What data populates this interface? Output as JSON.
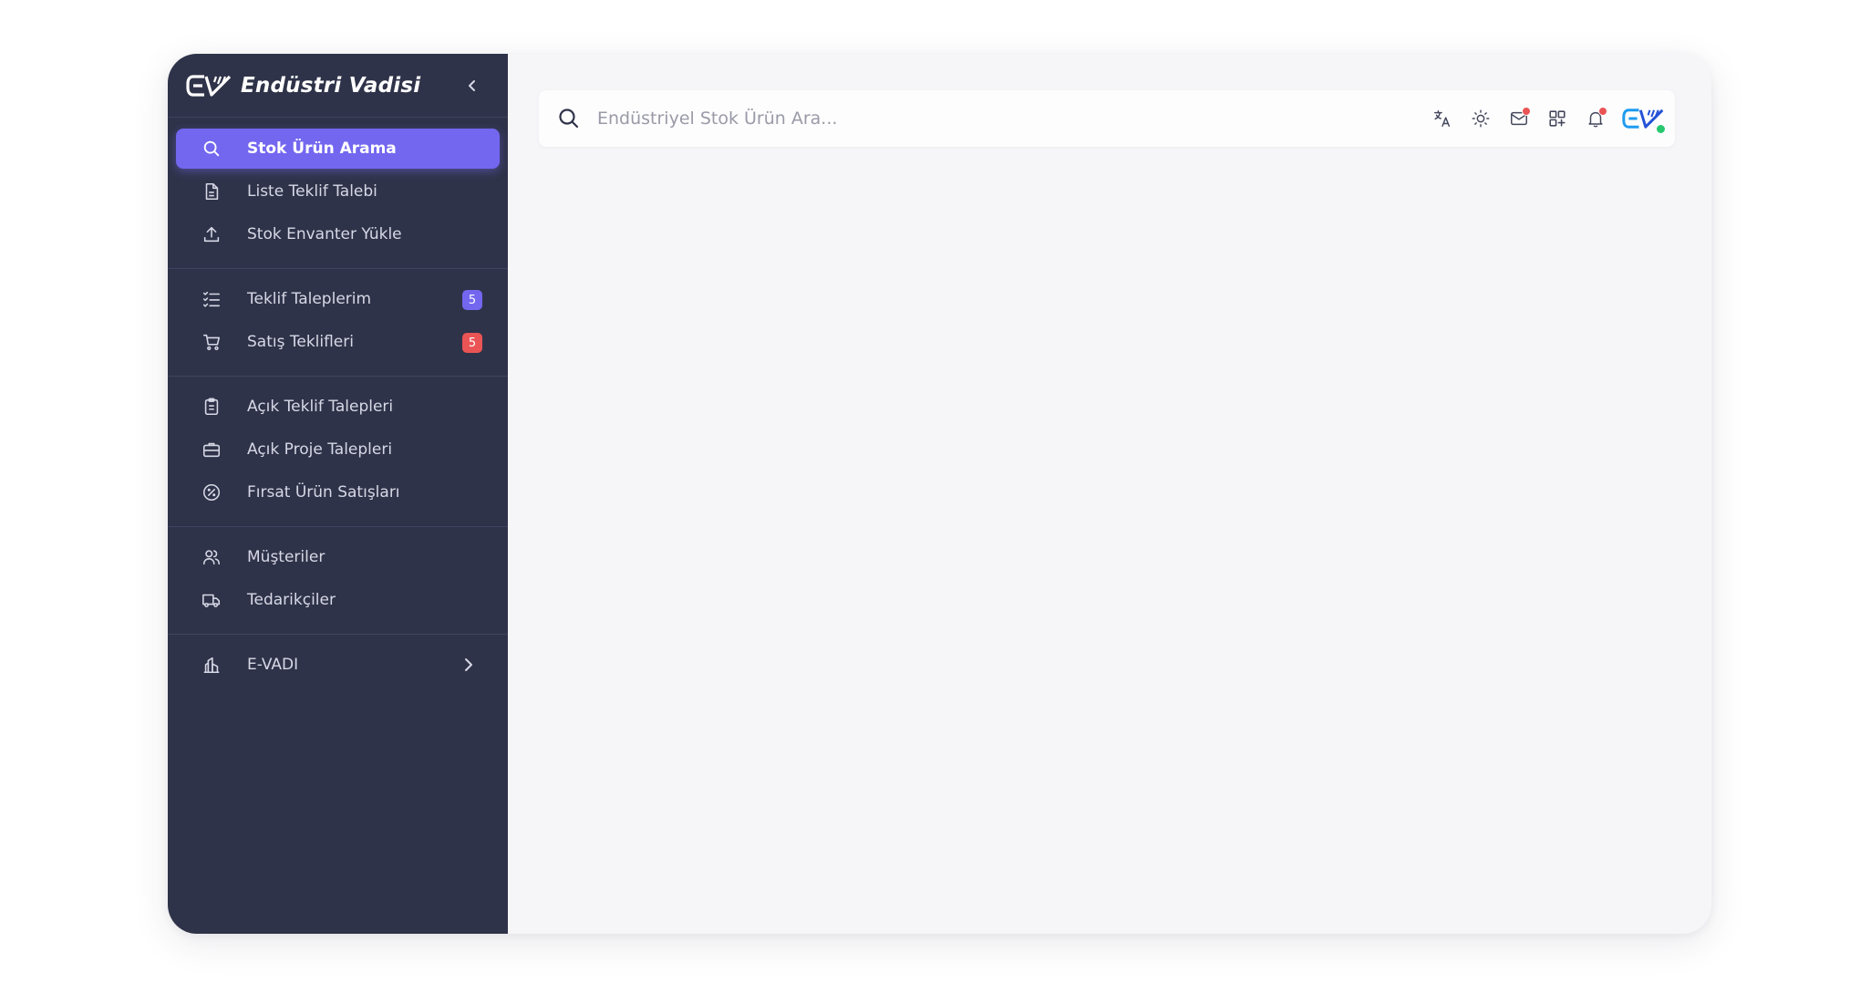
{
  "brand": {
    "name": "Endüstri Vadisi",
    "logo_icon": "ev-logo",
    "collapse_icon": "chevron-left-icon"
  },
  "sidebar": {
    "sections": [
      {
        "items": [
          {
            "label": "Stok Ürün Arama",
            "icon": "search-icon",
            "active": true
          },
          {
            "label": "Liste Teklif Talebi",
            "icon": "file-text-icon"
          },
          {
            "label": "Stok Envanter Yükle",
            "icon": "upload-icon"
          }
        ]
      },
      {
        "items": [
          {
            "label": "Teklif Taleplerim",
            "icon": "checklist-icon",
            "badge": "5",
            "badge_color": "#7367f0"
          },
          {
            "label": "Satış Teklifleri",
            "icon": "cart-icon",
            "badge": "5",
            "badge_color": "#ea5455"
          }
        ]
      },
      {
        "items": [
          {
            "label": "Açık Teklif Talepleri",
            "icon": "clipboard-icon"
          },
          {
            "label": "Açık Proje Talepleri",
            "icon": "briefcase-icon"
          },
          {
            "label": "Fırsat Ürün Satışları",
            "icon": "discount-icon"
          }
        ]
      },
      {
        "items": [
          {
            "label": "Müşteriler",
            "icon": "users-icon"
          },
          {
            "label": "Tedarikçiler",
            "icon": "truck-icon"
          }
        ]
      },
      {
        "items": [
          {
            "label": "E-VADI",
            "icon": "building-icon",
            "expandable": true
          }
        ]
      }
    ]
  },
  "topbar": {
    "search_placeholder": "Endüstriyel Stok Ürün Ara...",
    "tools": [
      "language-icon",
      "sun-icon",
      "mail-icon",
      "apps-icon",
      "bell-icon"
    ],
    "avatar": "ev-logo"
  },
  "colors": {
    "sidebar_bg": "#2f3349",
    "accent": "#7367f0",
    "danger": "#ea5455",
    "success": "#28c76f",
    "content_bg": "#f6f6f9"
  }
}
